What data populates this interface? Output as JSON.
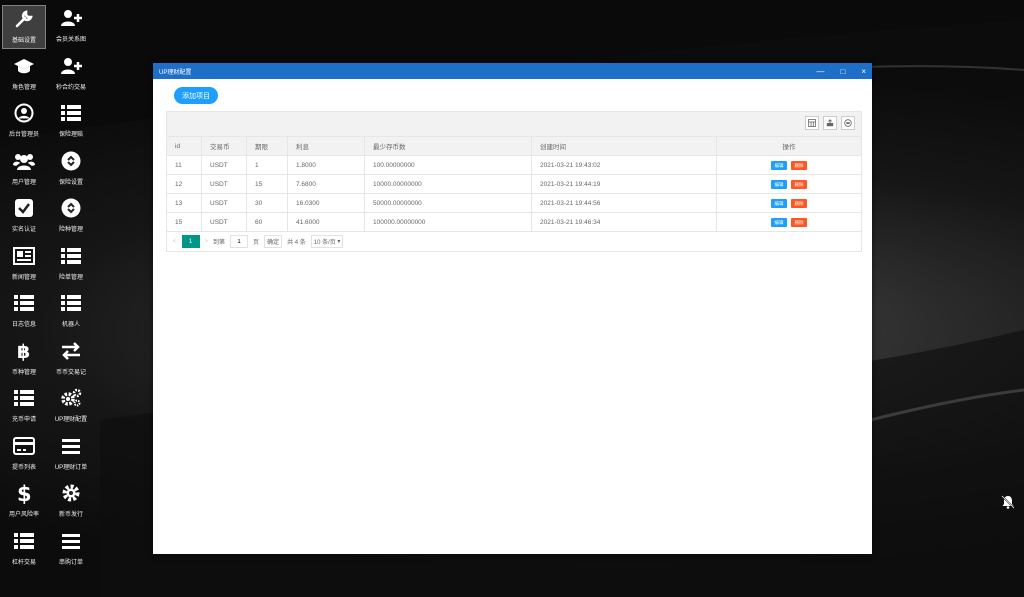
{
  "desktop": {
    "icons": [
      {
        "label": "基础设置",
        "icon": "wrench-icon"
      },
      {
        "label": "会员关系图",
        "icon": "user-plus-icon"
      },
      {
        "label": "角色管理",
        "icon": "graduation-cap-icon"
      },
      {
        "label": "秒合约交易",
        "icon": "user-plus-icon"
      },
      {
        "label": "后台管理员",
        "icon": "user-circle-icon"
      },
      {
        "label": "保险理赔",
        "icon": "list-icon"
      },
      {
        "label": "用户管理",
        "icon": "users-icon"
      },
      {
        "label": "保险设置",
        "icon": "link-circle-icon"
      },
      {
        "label": "实名认证",
        "icon": "check-square-icon"
      },
      {
        "label": "险种管理",
        "icon": "link-circle-icon"
      },
      {
        "label": "新闻管理",
        "icon": "newspaper-icon"
      },
      {
        "label": "险单管理",
        "icon": "list-icon"
      },
      {
        "label": "日志信息",
        "icon": "list-icon"
      },
      {
        "label": "机器人",
        "icon": "list-icon"
      },
      {
        "label": "币种管理",
        "icon": "bitcoin-icon"
      },
      {
        "label": "币币交易记",
        "icon": "exchange-icon"
      },
      {
        "label": "充币申请",
        "icon": "list-icon"
      },
      {
        "label": "UP理财配置",
        "icon": "cogs-icon"
      },
      {
        "label": "提币列表",
        "icon": "credit-card-icon"
      },
      {
        "label": "UP理财订单",
        "icon": "bars-icon"
      },
      {
        "label": "用户风险率",
        "icon": "dollar-icon"
      },
      {
        "label": "新币发行",
        "icon": "gear-icon"
      },
      {
        "label": "杠杆交易",
        "icon": "list-icon"
      },
      {
        "label": "串购订单",
        "icon": "bars-icon"
      }
    ]
  },
  "window": {
    "title": "UP理财配置",
    "minimize": "—",
    "maximize": "□",
    "close": "×"
  },
  "add_button": "添加项目",
  "table": {
    "headers": [
      "id",
      "交易币",
      "期限",
      "利息",
      "最少存币数",
      "创建时间",
      "操作"
    ],
    "rows": [
      [
        "11",
        "USDT",
        "1",
        "1.8000",
        "100.00000000",
        "2021-03-21 19:43:02"
      ],
      [
        "12",
        "USDT",
        "15",
        "7.6800",
        "10000.00000000",
        "2021-03-21 19:44:19"
      ],
      [
        "13",
        "USDT",
        "30",
        "16.0300",
        "50000.00000000",
        "2021-03-21 19:44:56"
      ],
      [
        "15",
        "USDT",
        "60",
        "41.6000",
        "100000.00000000",
        "2021-03-21 19:46:34"
      ]
    ],
    "edit_label": "编辑",
    "delete_label": "删除"
  },
  "pagination": {
    "prev": "<",
    "current": "1",
    "next": ">",
    "goto_label": "到第",
    "goto_value": "1",
    "page_unit": "页",
    "confirm": "确定",
    "total": "共 4 条",
    "per_page": "10 条/页"
  }
}
